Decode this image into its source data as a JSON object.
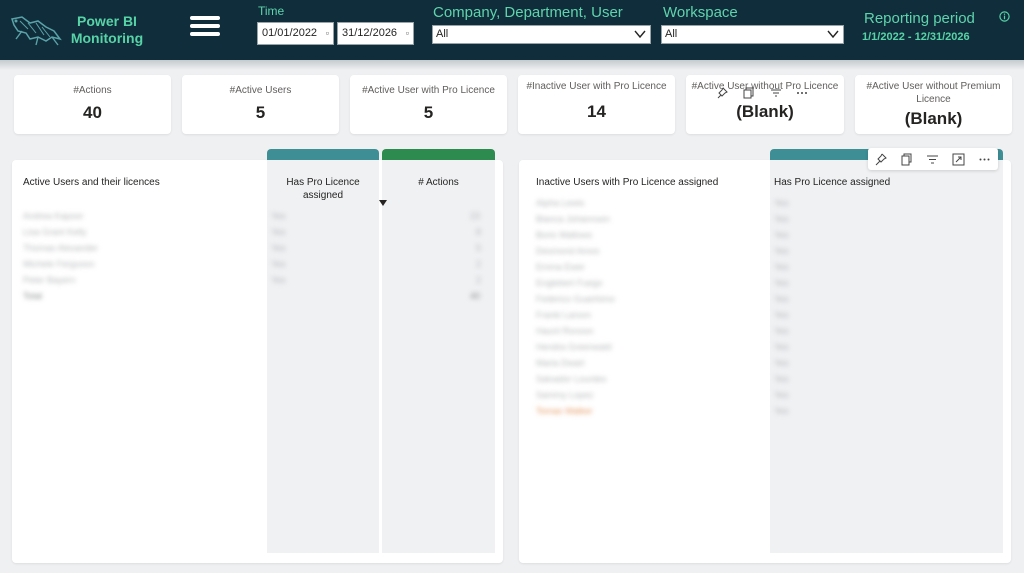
{
  "header": {
    "brand_line1": "Power BI",
    "brand_line2": "Monitoring",
    "time_label": "Time",
    "date_from": "01/01/2022",
    "date_to": "31/12/2026",
    "company_label": "Company, Department, User",
    "company_value": "All",
    "workspace_label": "Workspace",
    "workspace_value": "All",
    "reporting_period_label": "Reporting period",
    "reporting_period_value": "1/1/2022 - 12/31/2026"
  },
  "kpis": [
    {
      "title": "#Actions",
      "value": "40"
    },
    {
      "title": "#Active Users",
      "value": "5"
    },
    {
      "title": "#Active User with Pro Licence",
      "value": "5"
    },
    {
      "title": "#Inactive User with Pro Licence",
      "value": "14"
    },
    {
      "title": "#Active User without Pro Licence",
      "value": "(Blank)"
    },
    {
      "title": "#Active User without Premium Licence",
      "value": "(Blank)"
    }
  ],
  "active_table": {
    "title": "Active Users and their licences",
    "col_pro": "Has Pro Licence assigned",
    "col_actions": "# Actions",
    "rows": [
      {
        "user": "Andrea Kapoor",
        "pro": "Yes",
        "actions": "23"
      },
      {
        "user": "Lisa Grant Kelly",
        "pro": "Yes",
        "actions": "8"
      },
      {
        "user": "Thomas Alexander",
        "pro": "Yes",
        "actions": "5"
      },
      {
        "user": "Michele Ferguson",
        "pro": "Yes",
        "actions": "2"
      },
      {
        "user": "Peter Bayern",
        "pro": "Yes",
        "actions": "2"
      }
    ],
    "total_label": "Total",
    "total_actions": "40"
  },
  "inactive_table": {
    "title": "Inactive Users with Pro Licence assigned",
    "col_pro": "Has Pro Licence assigned",
    "rows": [
      {
        "user": "Alpha Lewis",
        "pro": "Yes"
      },
      {
        "user": "Bianca Johannsen",
        "pro": "Yes"
      },
      {
        "user": "Boris Wallows",
        "pro": "Yes"
      },
      {
        "user": "Desmond Amos",
        "pro": "Yes"
      },
      {
        "user": "Emma Ewer",
        "pro": "Yes"
      },
      {
        "user": "Englebert Fuego",
        "pro": "Yes"
      },
      {
        "user": "Federico Guanhimo",
        "pro": "Yes"
      },
      {
        "user": "Franki Larson",
        "pro": "Yes"
      },
      {
        "user": "Haunt Ronson",
        "pro": "Yes"
      },
      {
        "user": "Hendra Greenwald",
        "pro": "Yes"
      },
      {
        "user": "Maria Dwart",
        "pro": "Yes"
      },
      {
        "user": "Salvador Lourdes",
        "pro": "Yes"
      },
      {
        "user": "Sammy Lopez",
        "pro": "Yes"
      },
      {
        "user": "Tomas Walker",
        "pro": "Yes"
      }
    ]
  },
  "icons": {
    "logo": "lizard-logo-icon",
    "menu": "hamburger-menu-icon",
    "info": "info-icon",
    "pin": "pin-icon",
    "copy": "copy-icon",
    "filter": "filter-icon",
    "focus": "focus-mode-icon",
    "more": "more-options-icon"
  },
  "colors": {
    "header_bg": "#102d3b",
    "accent_green": "#57d3a6",
    "teal_bar": "#3e8e95",
    "green_bar": "#2e8b4f"
  }
}
